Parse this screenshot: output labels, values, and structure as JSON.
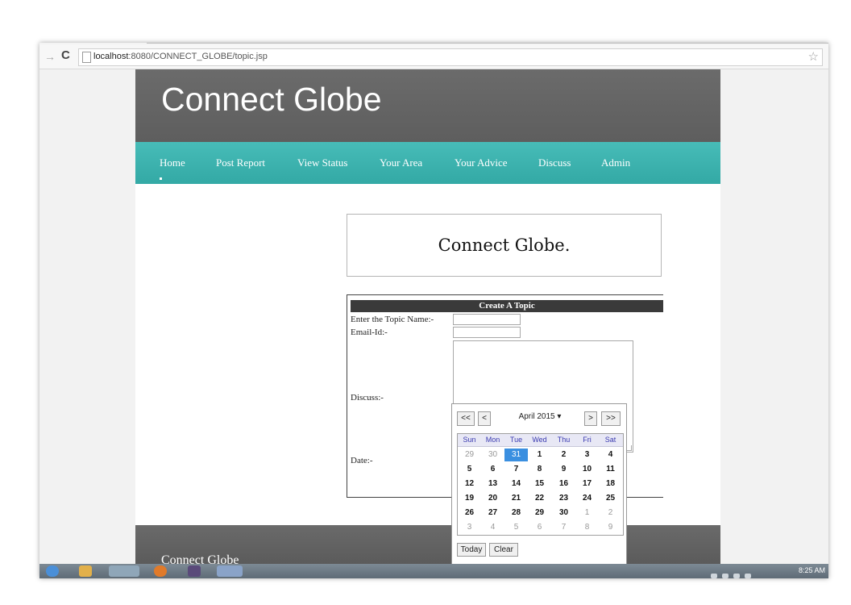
{
  "browser": {
    "url_host": "localhost",
    "url_rest": ":8080/CONNECT_GLOBE/topic.jsp"
  },
  "site": {
    "logo": "Connect Globe",
    "nav": [
      "Home",
      "Post Report",
      "View Status",
      "Your Area",
      "Your Advice",
      "Discuss",
      "Admin"
    ],
    "banner_title": "Connect Globe.",
    "footer": "Connect Globe"
  },
  "form": {
    "heading": "Create A Topic",
    "topic_label": "Enter the Topic Name:-",
    "email_label": "Email-Id:-",
    "discuss_label": "Discuss:-",
    "date_label": "Date:-",
    "topic_value": "",
    "email_value": ""
  },
  "calendar": {
    "prev_year": "<<",
    "prev_month": "<",
    "month_label": "April 2015 ▾",
    "next_month": ">",
    "next_year": ">>",
    "weekdays": [
      "Sun",
      "Mon",
      "Tue",
      "Wed",
      "Thu",
      "Fri",
      "Sat"
    ],
    "weeks": [
      [
        "29",
        "30",
        "31",
        "1",
        "2",
        "3",
        "4"
      ],
      [
        "5",
        "6",
        "7",
        "8",
        "9",
        "10",
        "11"
      ],
      [
        "12",
        "13",
        "14",
        "15",
        "16",
        "17",
        "18"
      ],
      [
        "19",
        "20",
        "21",
        "22",
        "23",
        "24",
        "25"
      ],
      [
        "26",
        "27",
        "28",
        "29",
        "30",
        "1",
        "2"
      ],
      [
        "3",
        "4",
        "5",
        "6",
        "7",
        "8",
        "9"
      ]
    ],
    "selected": "31",
    "today_btn": "Today",
    "clear_btn": "Clear"
  },
  "taskbar": {
    "clock": "8:25 AM"
  },
  "colors": {
    "header": "#646464",
    "nav": "#3db3af",
    "selected_day": "#3a8fe0"
  }
}
